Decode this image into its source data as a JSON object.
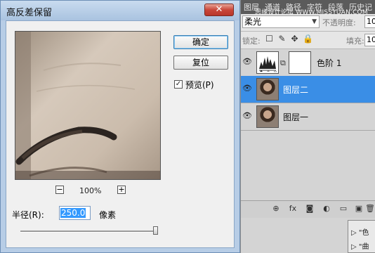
{
  "dialog": {
    "title": "高反差保留",
    "close_label": "✕",
    "ok_label": "确定",
    "reset_label": "复位",
    "preview_checkbox_label": "预览(P)",
    "preview_checkbox_checked": "✓",
    "zoom_out_label": "−",
    "zoom_in_label": "+",
    "zoom_level": "100%",
    "radius_label": "半径(R):",
    "radius_value": "250.0",
    "radius_unit": "像素",
    "radius_slider_fraction": 0.98
  },
  "photoshop": {
    "tabs": [
      "图层",
      "通道",
      "路径",
      "字符",
      "段落",
      "历史记"
    ],
    "watermark": "思缘设计论坛  WWW.MISSYUAN.COM",
    "blend_mode": "柔光",
    "blend_arrow": "▼",
    "opacity_label": "不透明度:",
    "opacity_value": "10",
    "lock_label": "锁定:",
    "lock_icons": [
      "☐",
      "✎",
      "✥",
      "🔒"
    ],
    "fill_label": "填充:",
    "fill_value": "10",
    "layers": [
      {
        "name": "色阶 1",
        "type": "adjustment",
        "selected": false,
        "visible_icon": "👁"
      },
      {
        "name": "图层二",
        "type": "photo",
        "selected": true,
        "visible_icon": "👁"
      },
      {
        "name": "图层一",
        "type": "photo",
        "selected": false,
        "visible_icon": "👁"
      }
    ],
    "toolbar_icons": [
      "⊕",
      "fx",
      "◙",
      "◐",
      "▭",
      "▣",
      "🗑"
    ],
    "sub_panel_items": [
      "▷ \"色",
      "▷ \"曲"
    ]
  },
  "colors": {
    "selected_layer": "#3a8ee6",
    "dialog_frame": "#b7cde6",
    "close_button": "#c9473a"
  }
}
